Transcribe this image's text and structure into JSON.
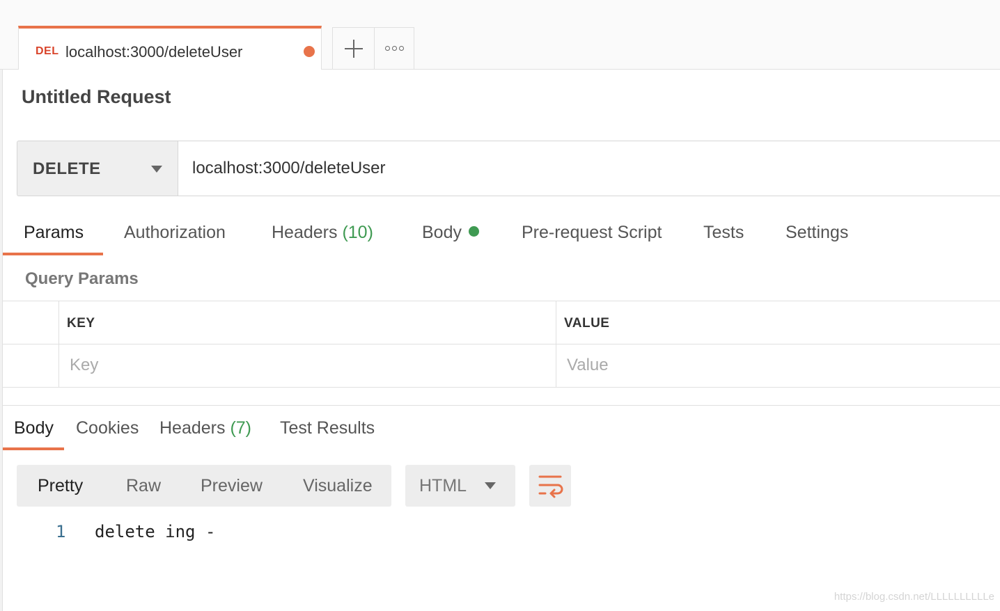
{
  "tab": {
    "method": "DEL",
    "title": "localhost:3000/deleteUser",
    "unsaved_indicator_color": "#e8734a"
  },
  "tab_actions": {
    "new_tab_icon": "plus-icon",
    "more_icon": "more-options-icon"
  },
  "request": {
    "name": "Untitled Request",
    "method": "DELETE",
    "url": "localhost:3000/deleteUser"
  },
  "request_tabs": [
    {
      "label": "Params",
      "active": true
    },
    {
      "label": "Authorization"
    },
    {
      "label": "Headers",
      "count": "(10)"
    },
    {
      "label": "Body",
      "indicator": "green-dot"
    },
    {
      "label": "Pre-request Script"
    },
    {
      "label": "Tests"
    },
    {
      "label": "Settings"
    }
  ],
  "query_params": {
    "title": "Query Params",
    "columns": [
      "KEY",
      "VALUE"
    ],
    "placeholders": {
      "key": "Key",
      "value": "Value"
    }
  },
  "response_tabs": [
    {
      "label": "Body",
      "active": true
    },
    {
      "label": "Cookies"
    },
    {
      "label": "Headers",
      "count": "(7)"
    },
    {
      "label": "Test Results"
    }
  ],
  "response_view": {
    "modes": [
      "Pretty",
      "Raw",
      "Preview",
      "Visualize"
    ],
    "active_mode": "Pretty",
    "format": "HTML",
    "wrap_icon": "wrap-lines-icon"
  },
  "response_body": {
    "lines": [
      {
        "number": "1",
        "text": "delete ing -"
      }
    ]
  },
  "watermark": "https://blog.csdn.net/LLLLLLLLLLe",
  "colors": {
    "accent": "#e8734a",
    "method_delete": "#d9442b",
    "count_green": "#3f9a52",
    "line_number": "#3a6f8f"
  }
}
